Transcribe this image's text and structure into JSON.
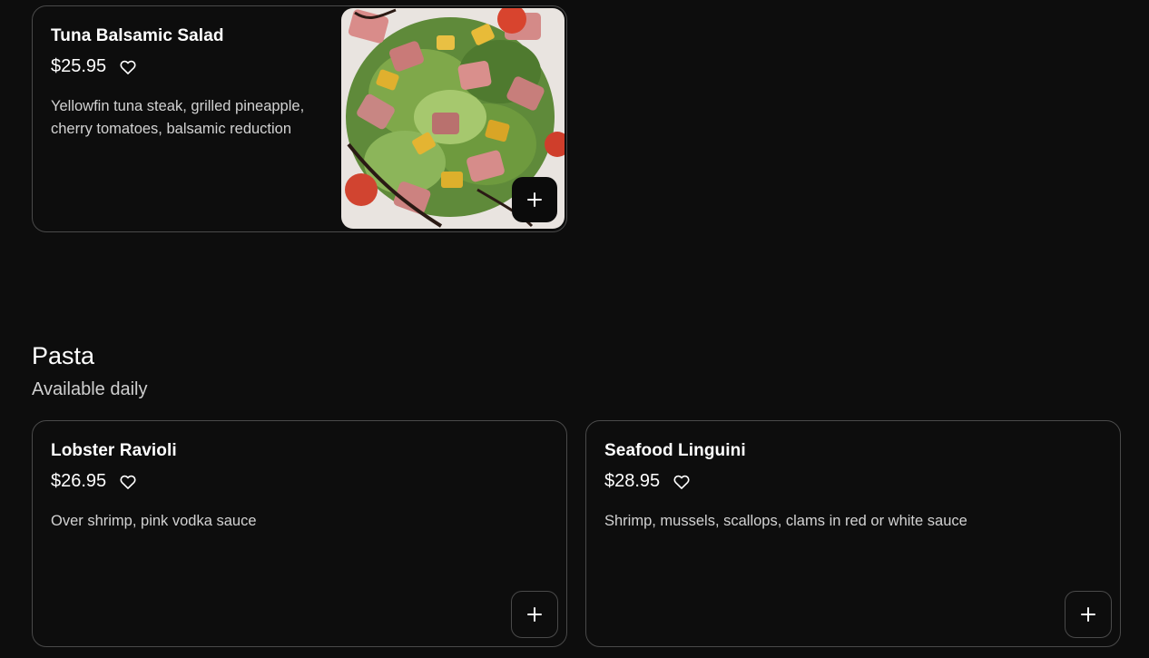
{
  "items": {
    "tuna": {
      "name": "Tuna Balsamic Salad",
      "price": "$25.95",
      "description": "Yellowfin tuna steak, grilled pineapple, cherry tomatoes, balsamic reduction"
    },
    "lobster": {
      "name": "Lobster Ravioli",
      "price": "$26.95",
      "description": "Over shrimp, pink vodka sauce"
    },
    "seafood": {
      "name": "Seafood Linguini",
      "price": "$28.95",
      "description": "Shrimp, mussels, scallops, clams in red or white sauce"
    }
  },
  "section": {
    "title": "Pasta",
    "subtitle": "Available daily"
  },
  "icons": {
    "favorite": "heart-icon",
    "add": "plus-icon"
  },
  "colors": {
    "background": "#0d0d0d",
    "card_border": "#4a4a4a",
    "text": "#ffffff",
    "muted_text": "#d2d2d2"
  }
}
